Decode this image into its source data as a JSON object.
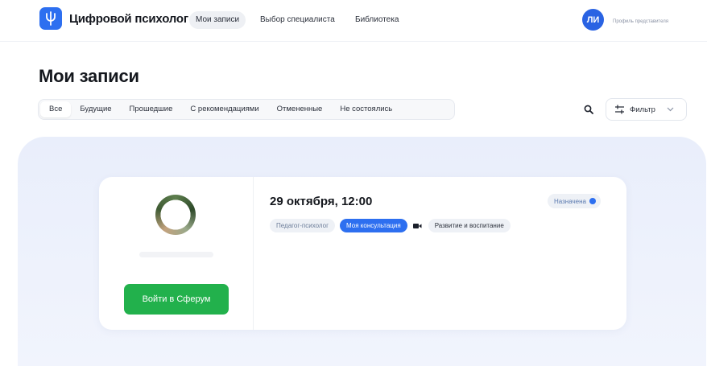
{
  "header": {
    "brand": "Цифровой психолог",
    "nav": [
      {
        "label": "Мои записи",
        "active": true
      },
      {
        "label": "Выбор специалиста",
        "active": false
      },
      {
        "label": "Библиотека",
        "active": false
      }
    ],
    "avatar_initials": "ЛИ",
    "profile_label": "Профиль представителя"
  },
  "page": {
    "title": "Мои записи"
  },
  "tabs": [
    {
      "label": "Все",
      "active": true
    },
    {
      "label": "Будущие",
      "active": false
    },
    {
      "label": "Прошедшие",
      "active": false
    },
    {
      "label": "С рекомендациями",
      "active": false
    },
    {
      "label": "Отмененные",
      "active": false
    },
    {
      "label": "Не состоялись",
      "active": false
    }
  ],
  "toolbar": {
    "filter_label": "Фильтр"
  },
  "appointment": {
    "date": "29 октября, 12:00",
    "status": "Назначена",
    "join_label": "Войти в Сферум",
    "chips": {
      "specialty": "Педагог-психолог",
      "type": "Моя консультация",
      "topic": "Развитие и воспитание"
    }
  },
  "colors": {
    "accent": "#2d6ff0",
    "join_button": "#22b14c",
    "panel_bg": "#e9eefb"
  }
}
